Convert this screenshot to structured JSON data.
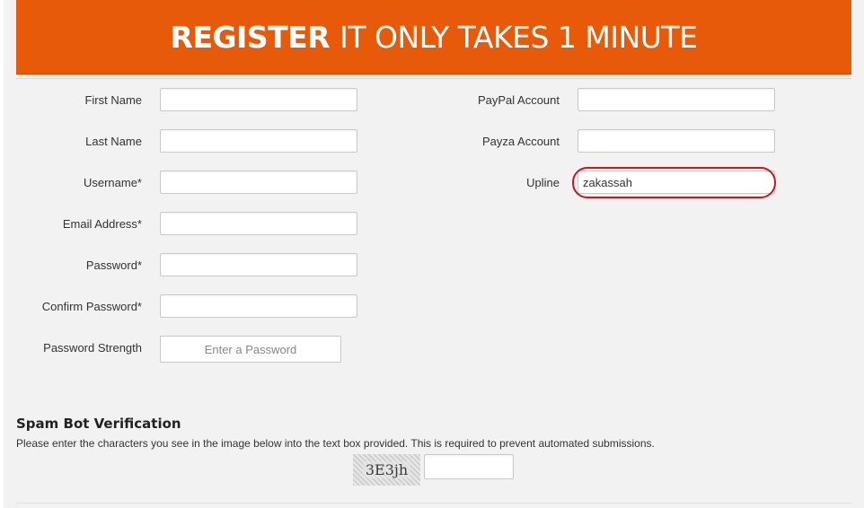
{
  "banner": {
    "strong": "REGISTER",
    "rest": "IT ONLY TAKES 1 MINUTE"
  },
  "form_left": {
    "first_name": {
      "label": "First Name",
      "value": ""
    },
    "last_name": {
      "label": "Last Name",
      "value": ""
    },
    "username": {
      "label": "Username*",
      "value": ""
    },
    "email": {
      "label": "Email Address*",
      "value": ""
    },
    "password": {
      "label": "Password*",
      "value": ""
    },
    "confirm_password": {
      "label": "Confirm Password*",
      "value": ""
    },
    "strength": {
      "label": "Password Strength",
      "value": "Enter a Password"
    }
  },
  "form_right": {
    "paypal": {
      "label": "PayPal Account",
      "value": ""
    },
    "payza": {
      "label": "Payza Account",
      "value": ""
    },
    "upline": {
      "label": "Upline",
      "value": "zakassah"
    }
  },
  "spam": {
    "title": "Spam Bot Verification",
    "description": "Please enter the characters you see in the image below into the text box provided. This is required to prevent automated submissions.",
    "captcha_text": "3E3jh",
    "answer": ""
  },
  "colors": {
    "banner": "#e65a0a",
    "highlight_ring": "#d0141c"
  }
}
